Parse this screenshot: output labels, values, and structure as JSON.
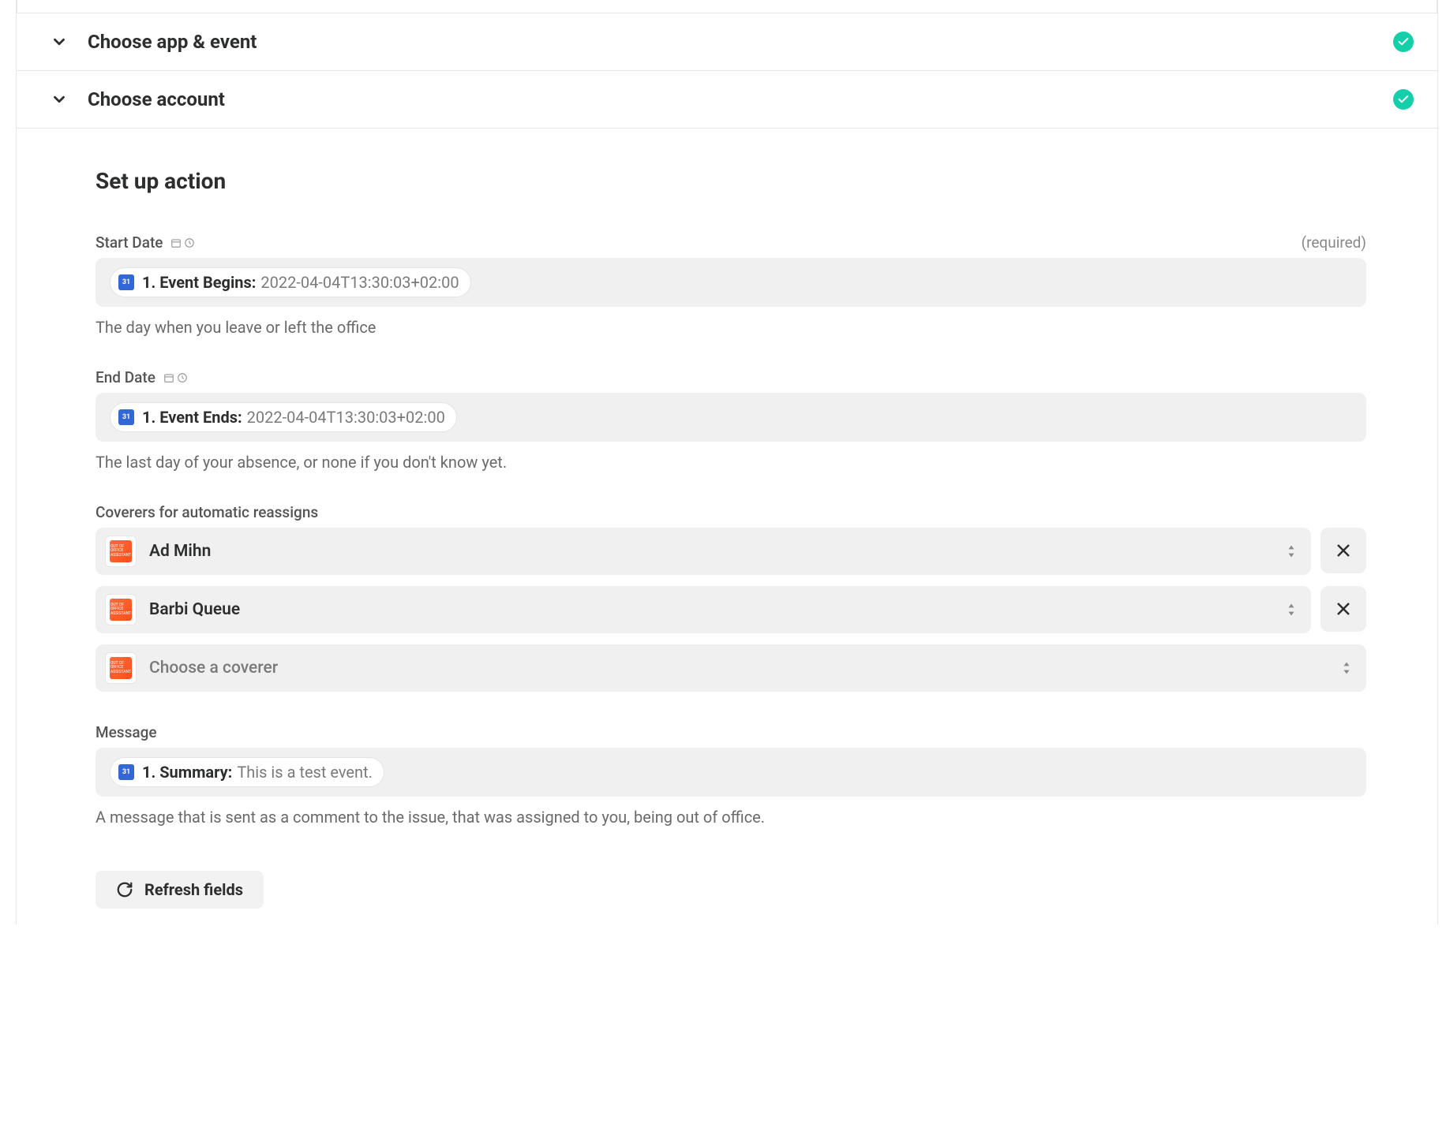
{
  "accordion": {
    "choose_app_event": "Choose app & event",
    "choose_account": "Choose account"
  },
  "section_title": "Set up action",
  "fields": {
    "start_date": {
      "label": "Start Date",
      "required_text": "(required)",
      "pill_label": "1. Event Begins:",
      "pill_value": "2022-04-04T13:30:03+02:00",
      "help": "The day when you leave or left the office"
    },
    "end_date": {
      "label": "End Date",
      "pill_label": "1. Event Ends:",
      "pill_value": "2022-04-04T13:30:03+02:00",
      "help": "The last day of your absence, or none if you don't know yet."
    },
    "coverers": {
      "label": "Coverers for automatic reassigns",
      "items": [
        {
          "name": "Ad Mihn"
        },
        {
          "name": "Barbi Queue"
        }
      ],
      "placeholder": "Choose a coverer"
    },
    "message": {
      "label": "Message",
      "pill_label": "1. Summary:",
      "pill_value": "This is a test event.",
      "help": "A message that is sent as a comment to the issue, that was assigned to you, being out of office."
    }
  },
  "refresh_label": "Refresh fields",
  "app_icon_text": "OUT OF OFFICE ASSISTANT"
}
